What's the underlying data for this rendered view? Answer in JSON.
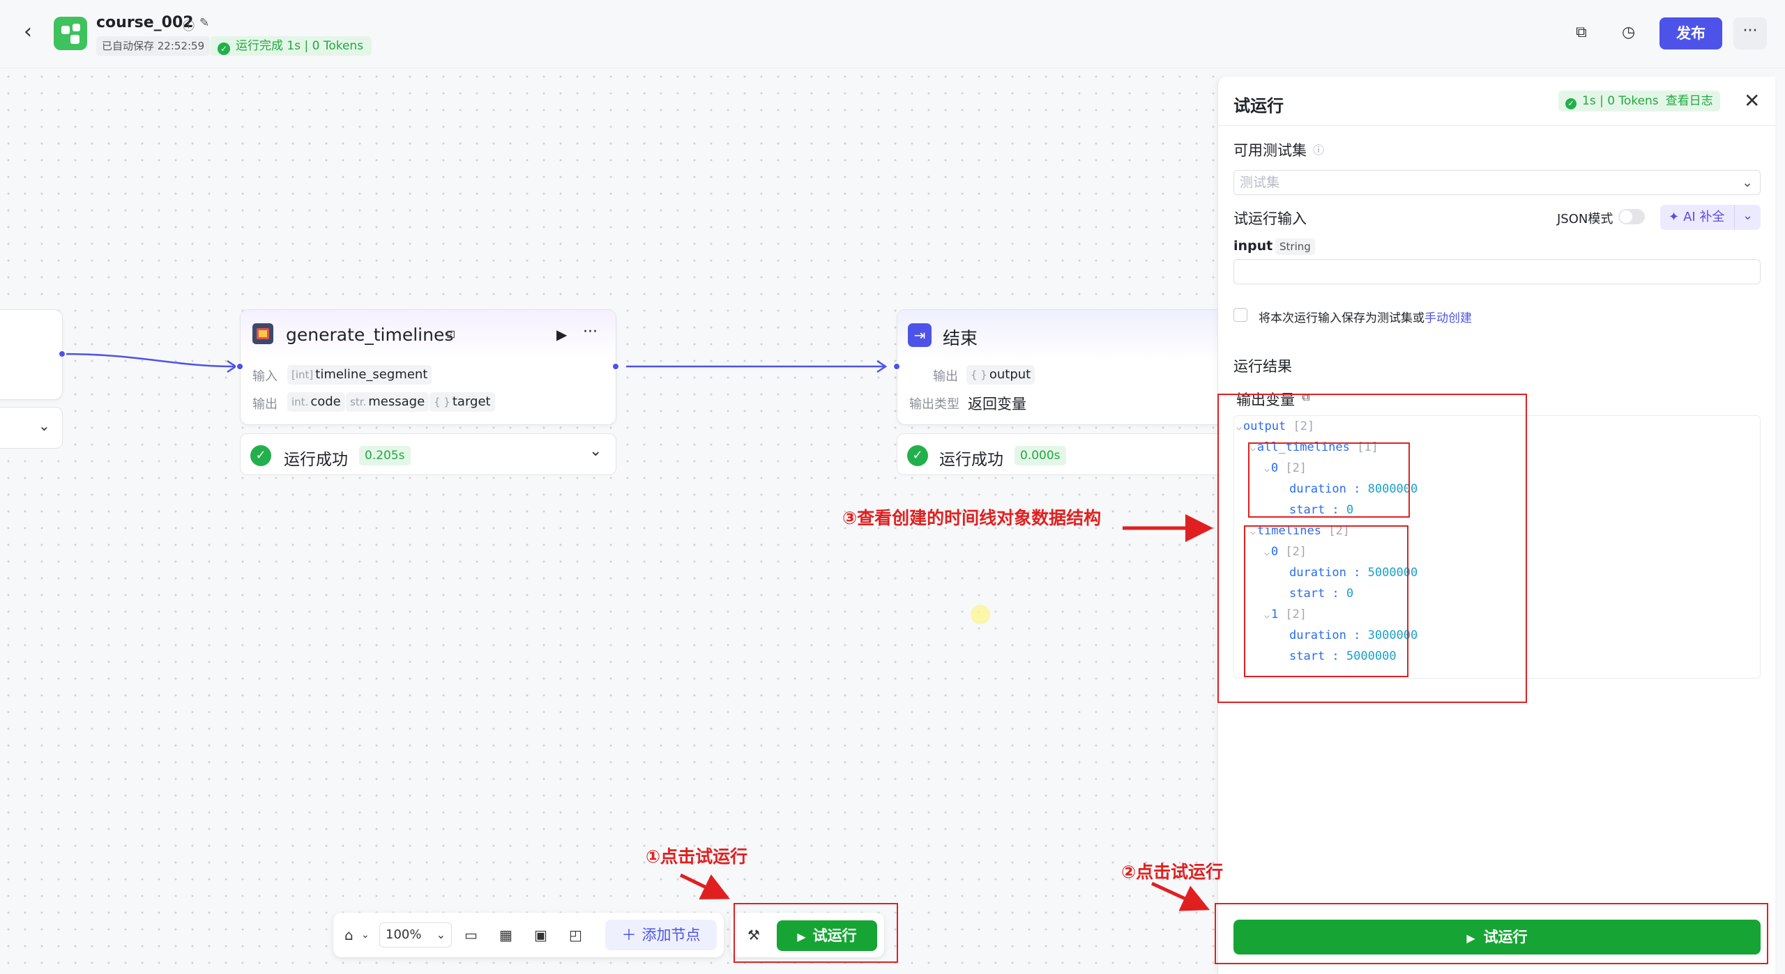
{
  "header": {
    "title": "course_002",
    "autosave": "已自动保存 22:52:59",
    "run_status": "运行完成 1s | 0 Tokens",
    "publish_label": "发布"
  },
  "canvas": {
    "node_generate": {
      "title": "generate_timelines",
      "input_label": "输入",
      "input_type": "[int]",
      "input_name": "timeline_segment",
      "output_label": "输出",
      "out1_type": "int.",
      "out1_name": "code",
      "out2_type": "str.",
      "out2_name": "message",
      "out3_type": "{ }",
      "out3_name": "target",
      "status": "运行成功",
      "time": "0.205s"
    },
    "node_end": {
      "title": "结束",
      "output_label": "输出",
      "output_type": "{ }",
      "output_name": "output",
      "output_kind_label": "输出类型",
      "output_kind_value": "返回变量",
      "status": "运行成功",
      "time": "0.000s"
    }
  },
  "toolbar": {
    "zoom": "100%",
    "add_node": "添加节点",
    "run_label": "试运行"
  },
  "panel": {
    "title": "试运行",
    "stat": "1s | 0 Tokens",
    "view_log": "查看日志",
    "test_set_label": "可用测试集",
    "test_set_placeholder": "测试集",
    "run_input_label": "试运行输入",
    "json_mode_label": "JSON模式",
    "ai_fill": "AI 补全",
    "input_name": "input",
    "input_type": "String",
    "save_text": "将本次运行输入保存为测试集或",
    "manual_create": "手动创建",
    "result_label": "运行结果",
    "output_var_label": "输出变量",
    "run_button": "试运行",
    "json_tree": {
      "output": "output",
      "output_count": "[2]",
      "all_timelines": "all_timelines",
      "all_count": "[1]",
      "idx0": "0",
      "idx0_count": "[2]",
      "a_duration_key": "duration",
      "a_duration_val": "8000000",
      "a_start_key": "start",
      "a_start_val": "0",
      "timelines": "timelines",
      "tl_count": "[2]",
      "t0": "0",
      "t0_count": "[2]",
      "t0_duration_val": "5000000",
      "t0_start_val": "0",
      "t1": "1",
      "t1_count": "[2]",
      "t1_duration_val": "3000000",
      "t1_start_val": "5000000"
    }
  },
  "annotations": {
    "a1": "①点击试运行",
    "a2": "②点击试运行",
    "a3": "③查看创建的时间线对象数据结构"
  },
  "colors": {
    "accent": "#4d53e8",
    "success": "#16a534",
    "annotation": "#e02020"
  }
}
